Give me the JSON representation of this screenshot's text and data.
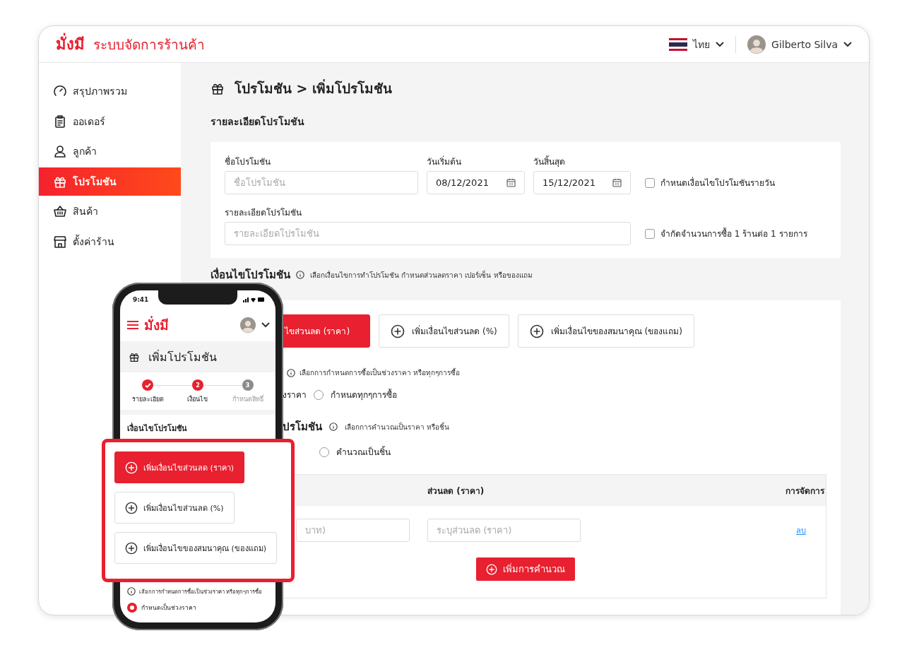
{
  "header": {
    "logo": "มั่งมี",
    "title": "ระบบจัดการร้านค้า",
    "language": "ไทย",
    "user": "Gilberto Silva"
  },
  "sidebar": {
    "items": [
      {
        "label": "สรุปภาพรวม",
        "selected": false
      },
      {
        "label": "ออเดอร์",
        "selected": false
      },
      {
        "label": "ลูกค้า",
        "selected": false
      },
      {
        "label": "โปรโมชัน",
        "selected": true
      },
      {
        "label": "สินค้า",
        "selected": false
      },
      {
        "label": "ตั้งค่าร้าน",
        "selected": false
      }
    ]
  },
  "page": {
    "breadcrumb": "โปรโมชัน > เพิ่มโปรโมชัน",
    "section_title": "รายละเอียดโปรโมชัน",
    "form": {
      "name_label": "ชื่อโปรโมชัน",
      "name_placeholder": "ชื่อโปรโมชัน",
      "start_label": "วันเริ่มต้น",
      "start_value": "08/12/2021",
      "end_label": "วันสิ้นสุด",
      "end_value": "15/12/2021",
      "daily_checkbox": {
        "label": "กำหนดเงื่อนไขโปรโมชันรายวัน",
        "checked": false
      },
      "detail_label": "รายละเอียดโปรโมชัน",
      "detail_placeholder": "รายละเอียดโปรโมชัน",
      "limit_checkbox": {
        "label": "จำกัดจำนวนการซื้อ 1 ร้านต่อ 1 รายการ",
        "checked": false
      }
    },
    "conditions": {
      "title": "เงื่อนไขโปรโมชัน",
      "hint": "เลือกเงื่อนไขการทำโปรโมชัน กำหนดส่วนลดราคา เปอร์เซ็น หรือของแถม",
      "type_buttons": [
        {
          "label": "ไขส่วนลด (ราคา)",
          "selected": true
        },
        {
          "label": "เพิ่มเงื่อนไขส่วนลด (%)",
          "selected": false
        },
        {
          "label": "เพิ่มเงื่อนไขของสมนาคุณ (ของแถม)",
          "selected": false
        }
      ],
      "purchase_hint": "เลือกการกำหนดการซื้อเป็นช่วงราคา หรือทุกๆการซื้อ",
      "purchase_fragment": "งราคา",
      "purchase_radio": {
        "label": "กำหนดทุกๆการซื้อ",
        "selected": false
      },
      "calc_title_fragment": "ปรโมชัน",
      "calc_hint": "เลือกการคำนวณเป็นราคา หรือชิ้น",
      "calc_radio": {
        "label": "คำนวณเป็นชิ้น",
        "selected": false
      },
      "table": {
        "columns": [
          "ส่วนลด (ราคา)",
          "การจัดการ"
        ],
        "row": {
          "price_placeholder": "บาท)",
          "discount_placeholder": "ระบุส่วนลด (ราคา)",
          "delete": "ลบ"
        }
      },
      "add_button": "เพิ่มการคำนวณ"
    }
  },
  "mobile": {
    "time": "9:41",
    "logo": "มั่งมี",
    "title": "เพิ่มโปรโมชัน",
    "steps": [
      {
        "label": "รายละเอียด",
        "kind": "done"
      },
      {
        "label": "เงื่อนไข",
        "number": "2",
        "kind": "current"
      },
      {
        "label": "กำหนดสิทธิ์",
        "number": "3",
        "kind": "upcoming"
      }
    ],
    "section_title": "เงื่อนไขโปรโมชัน",
    "callout_buttons": [
      {
        "label": "เพิ่มเงื่อนไขส่วนลด (ราคา)",
        "selected": true
      },
      {
        "label": "เพิ่มเงื่อนไขส่วนลด (%)",
        "selected": false
      },
      {
        "label": "เพิ่มเงื่อนไขของสมนาคุณ (ของแถม)",
        "selected": false
      }
    ],
    "hint": "เลือกการกำหนดการซื้อเป็นช่วงราคา หรือทุกๆการซื้อ",
    "radio": {
      "label": "กำหนดเป็นช่วงราคา",
      "selected": true
    }
  }
}
